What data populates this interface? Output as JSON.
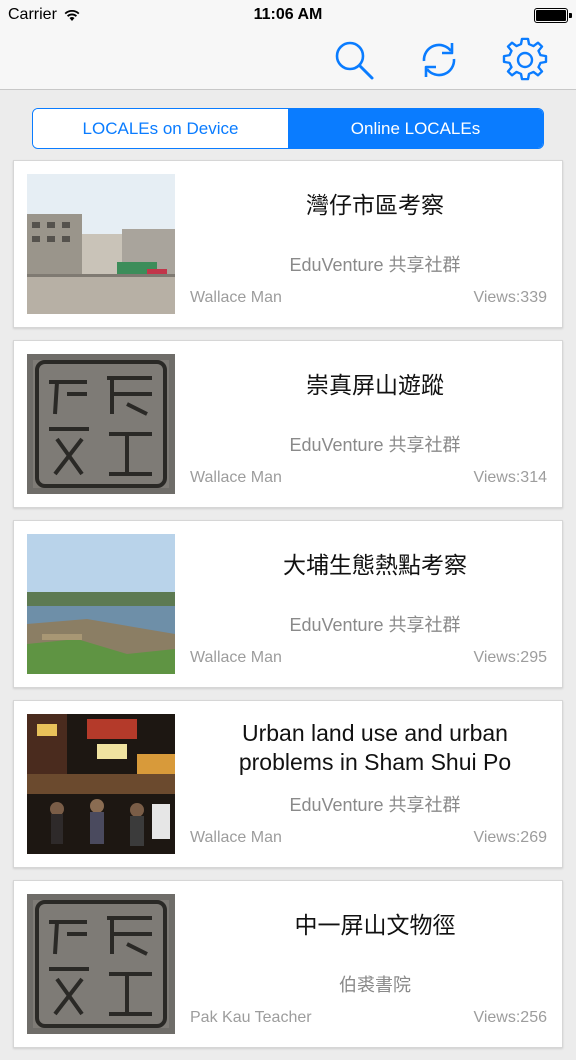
{
  "status_bar": {
    "carrier": "Carrier",
    "time": "11:06 AM"
  },
  "navbar": {
    "icons": [
      "search-icon",
      "refresh-icon",
      "gear-icon"
    ],
    "accent": "#0a7cff"
  },
  "segments": [
    {
      "label": "LOCALEs on Device",
      "selected": false
    },
    {
      "label": "Online LOCALEs",
      "selected": true
    }
  ],
  "locales": [
    {
      "title": "灣仔市區考察",
      "community": "EduVenture 共享社群",
      "author": "Wallace Man",
      "views": "Views:339"
    },
    {
      "title": "崇真屏山遊蹤",
      "community": "EduVenture 共享社群",
      "author": "Wallace Man",
      "views": "Views:314"
    },
    {
      "title": "大埔生態熱點考察",
      "community": "EduVenture 共享社群",
      "author": "Wallace Man",
      "views": "Views:295"
    },
    {
      "title": "Urban land use and urban problems in Sham Shui Po",
      "community": "EduVenture 共享社群",
      "author": "Wallace Man",
      "views": "Views:269"
    },
    {
      "title": "中一屏山文物徑",
      "community": "伯裘書院",
      "author": "Pak Kau Teacher",
      "views": "Views:256"
    }
  ]
}
